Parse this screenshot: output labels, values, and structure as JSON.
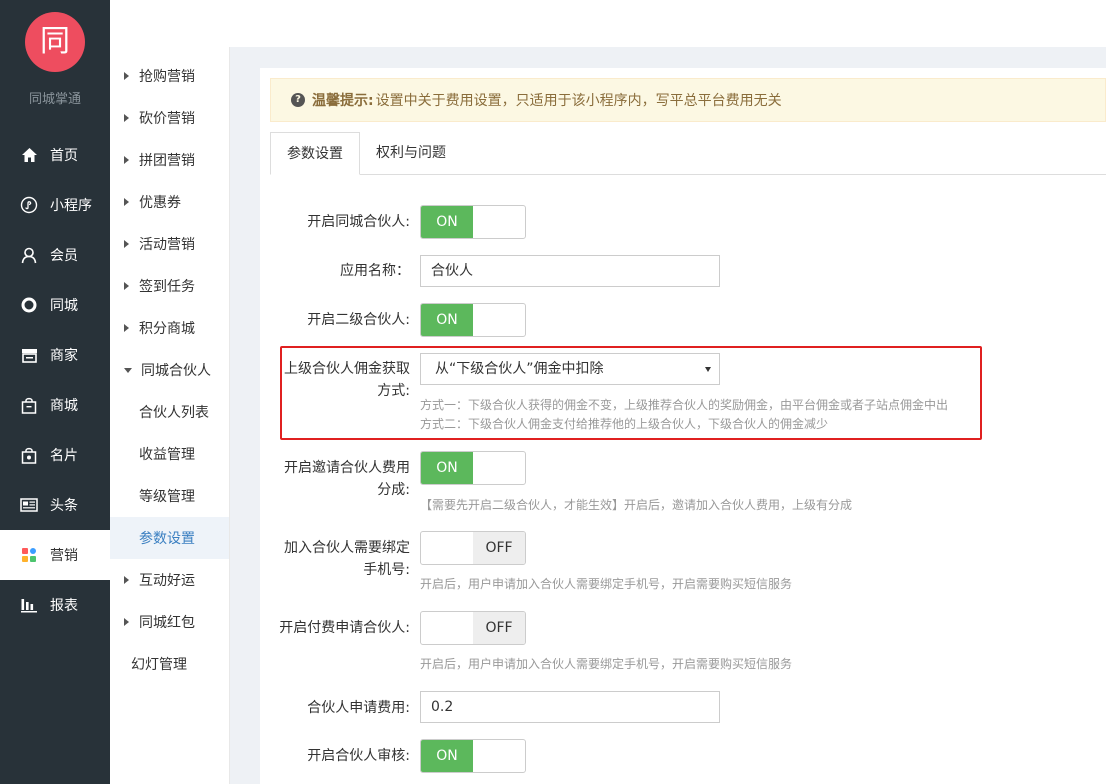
{
  "brand": {
    "logo_char": "同",
    "name": "同城掌通"
  },
  "nav": [
    {
      "label": "首页",
      "icon": "home-icon"
    },
    {
      "label": "小程序",
      "icon": "mini-program-icon"
    },
    {
      "label": "会员",
      "icon": "member-icon"
    },
    {
      "label": "同城",
      "icon": "ring-icon"
    },
    {
      "label": "商家",
      "icon": "store-icon"
    },
    {
      "label": "商城",
      "icon": "mall-icon"
    },
    {
      "label": "名片",
      "icon": "card-icon"
    },
    {
      "label": "头条",
      "icon": "news-icon"
    },
    {
      "label": "营销",
      "icon": "marketing-icon",
      "active": true
    },
    {
      "label": "报表",
      "icon": "report-icon"
    }
  ],
  "subnav": [
    "抢购营销",
    "砍价营销",
    "拼团营销",
    "优惠券",
    "活动营销",
    "签到任务",
    "积分商城",
    "同城合伙人",
    "合伙人列表",
    "收益管理",
    "等级管理",
    "参数设置",
    "互动好运",
    "同城红包",
    "幻灯管理"
  ],
  "tip": {
    "title": "温馨提示:",
    "text": "设置中关于费用设置，只适用于该小程序内，写平总平台费用无关"
  },
  "tabs": [
    "参数设置",
    "权利与问题"
  ],
  "form": {
    "enable_partner": {
      "label": "开启同城合伙人:",
      "state": "ON"
    },
    "app_name": {
      "label": "应用名称：",
      "value": "合伙人"
    },
    "enable_level2": {
      "label": "开启二级合伙人:",
      "state": "ON"
    },
    "commission_method": {
      "label_line1": "上级合伙人佣金获取",
      "label_line2": "方式:",
      "selected": "从“下级合伙人”佣金中扣除",
      "help1": "方式一：下级合伙人获得的佣金不变，上级推荐合伙人的奖励佣金，由平台佣金或者子站点佣金中出",
      "help2": "方式二：下级合伙人佣金支付给推荐他的上级合伙人，下级合伙人的佣金减少"
    },
    "invite_fee": {
      "label_line1": "开启邀请合伙人费用",
      "label_line2": "分成:",
      "state": "ON",
      "help": "【需要先开启二级合伙人，才能生效】开启后，邀请加入合伙人费用，上级有分成"
    },
    "bind_phone": {
      "label_line1": "加入合伙人需要绑定",
      "label_line2": "手机号:",
      "state": "OFF",
      "help": "开启后，用户申请加入合伙人需要绑定手机号，开启需要购买短信服务"
    },
    "paid_apply": {
      "label": "开启付费申请合伙人:",
      "state": "OFF",
      "help": "开启后，用户申请加入合伙人需要绑定手机号，开启需要购买短信服务"
    },
    "apply_fee": {
      "label": "合伙人申请费用:",
      "value": "0.2"
    },
    "enable_review": {
      "label": "开启合伙人审核:",
      "state": "ON"
    }
  },
  "colors": {
    "sidebar": "#283239",
    "accent": "#5cb85c",
    "logo": "#ee4d5f",
    "highlight": "#e02020"
  }
}
